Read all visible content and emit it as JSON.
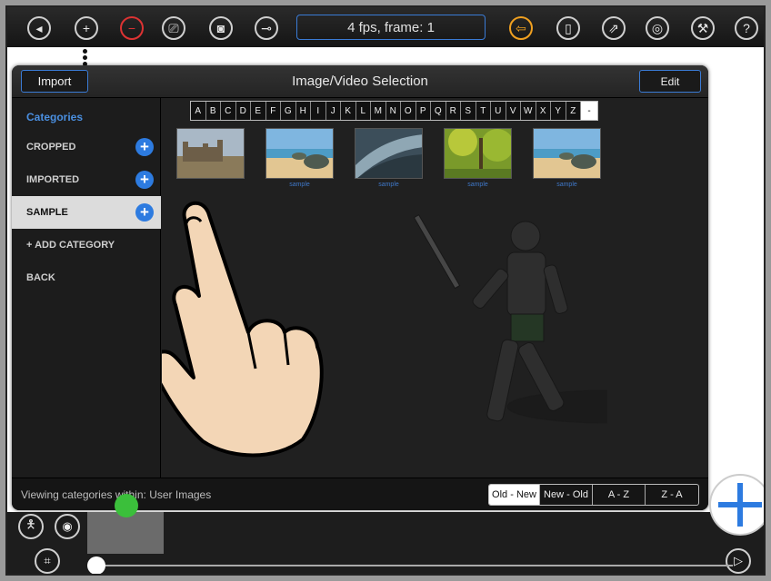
{
  "toolbar": {
    "fps_frame": "4 fps, frame: 1"
  },
  "dialog": {
    "title": "Image/Video Selection",
    "import_label": "Import",
    "edit_label": "Edit"
  },
  "sidebar": {
    "header": "Categories",
    "items": [
      {
        "label": "CROPPED",
        "has_add": true
      },
      {
        "label": "IMPORTED",
        "has_add": true
      },
      {
        "label": "SAMPLE",
        "has_add": true
      },
      {
        "label": "+ ADD CATEGORY",
        "has_add": false
      },
      {
        "label": "BACK",
        "has_add": false
      }
    ]
  },
  "alphabet": [
    "A",
    "B",
    "C",
    "D",
    "E",
    "F",
    "G",
    "H",
    "I",
    "J",
    "K",
    "L",
    "M",
    "N",
    "O",
    "P",
    "Q",
    "R",
    "S",
    "T",
    "U",
    "V",
    "W",
    "X",
    "Y",
    "Z",
    "-"
  ],
  "thumbnails": [
    {
      "label": "",
      "scene": "castle"
    },
    {
      "label": "sample",
      "scene": "beach"
    },
    {
      "label": "sample",
      "scene": "water"
    },
    {
      "label": "sample",
      "scene": "forest"
    },
    {
      "label": "sample",
      "scene": "beach"
    }
  ],
  "footer": {
    "status": "Viewing categories within: User Images",
    "sort_options": [
      "Old - New",
      "New - Old",
      "A - Z",
      "Z - A"
    ],
    "active_sort": "Old - New"
  },
  "colors": {
    "accent": "#3a7bd5",
    "category_header": "#4a8fe0",
    "add_button": "#2d7be0",
    "playhead": "#3bbf3b"
  }
}
